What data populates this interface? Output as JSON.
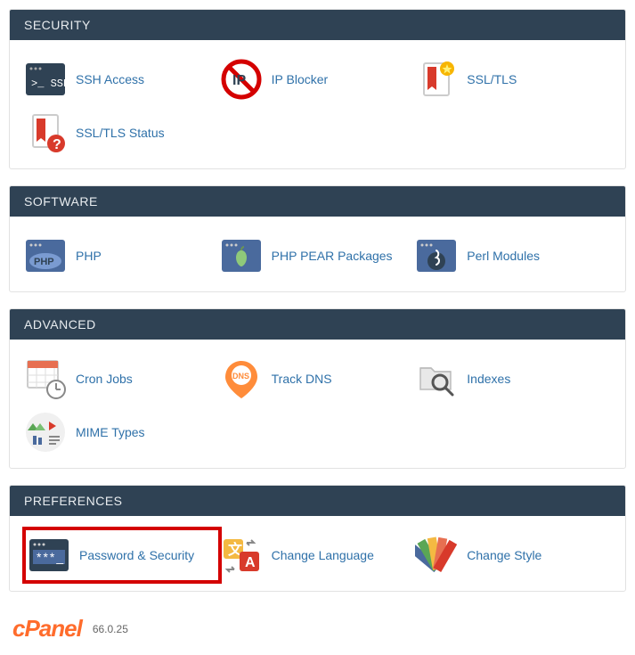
{
  "sections": [
    {
      "title": "SECURITY",
      "items": [
        {
          "label": "SSH Access"
        },
        {
          "label": "IP Blocker"
        },
        {
          "label": "SSL/TLS"
        },
        {
          "label": "SSL/TLS Status"
        }
      ]
    },
    {
      "title": "SOFTWARE",
      "items": [
        {
          "label": "PHP"
        },
        {
          "label": "PHP PEAR Packages"
        },
        {
          "label": "Perl Modules"
        }
      ]
    },
    {
      "title": "ADVANCED",
      "items": [
        {
          "label": "Cron Jobs"
        },
        {
          "label": "Track DNS"
        },
        {
          "label": "Indexes"
        },
        {
          "label": "MIME Types"
        }
      ]
    },
    {
      "title": "PREFERENCES",
      "items": [
        {
          "label": "Password & Security",
          "highlighted": true
        },
        {
          "label": "Change Language"
        },
        {
          "label": "Change Style"
        }
      ]
    }
  ],
  "footer": {
    "logo_text": "cPanel",
    "version": "66.0.25"
  }
}
